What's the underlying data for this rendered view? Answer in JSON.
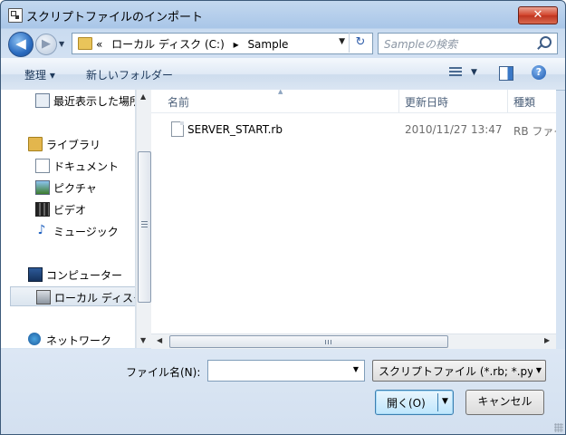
{
  "window": {
    "title": "スクリプトファイルのインポート",
    "close_glyph": "✕"
  },
  "navbar": {
    "back_glyph": "◀",
    "forward_glyph": "▶",
    "breadcrumb": [
      "«",
      "ローカル ディスク (C:)",
      "▸",
      "Sample"
    ],
    "search_placeholder": "Sampleの検索"
  },
  "toolbar": {
    "organize": "整理 ▾",
    "new_folder": "新しいフォルダー",
    "help_glyph": "?"
  },
  "nav_pane": {
    "items": [
      {
        "label": "最近表示した場所",
        "icon": "recent-places-icon"
      },
      {
        "label": "ライブラリ",
        "icon": "library-icon"
      },
      {
        "label": "ドキュメント",
        "icon": "documents-icon"
      },
      {
        "label": "ピクチャ",
        "icon": "pictures-icon"
      },
      {
        "label": "ビデオ",
        "icon": "videos-icon"
      },
      {
        "label": "ミュージック",
        "icon": "music-icon"
      },
      {
        "label": "コンピューター",
        "icon": "computer-icon"
      },
      {
        "label": "ローカル ディスク",
        "icon": "drive-icon",
        "selected": true
      },
      {
        "label": "ネットワーク",
        "icon": "network-icon"
      }
    ]
  },
  "file_list": {
    "columns": [
      "名前",
      "更新日時",
      "種類"
    ],
    "rows": [
      {
        "name": "SERVER_START.rb",
        "modified": "2010/11/27 13:47",
        "type": "RB ファイル"
      }
    ]
  },
  "footer": {
    "filename_label": "ファイル名(N):",
    "filename_value": "",
    "filter_value": "スクリプトファイル (*.rb; *.py)",
    "open_label": "開く(O)",
    "cancel_label": "キャンセル"
  },
  "colors": {
    "accent": "#2b6cc0",
    "close_red": "#c0341f"
  }
}
